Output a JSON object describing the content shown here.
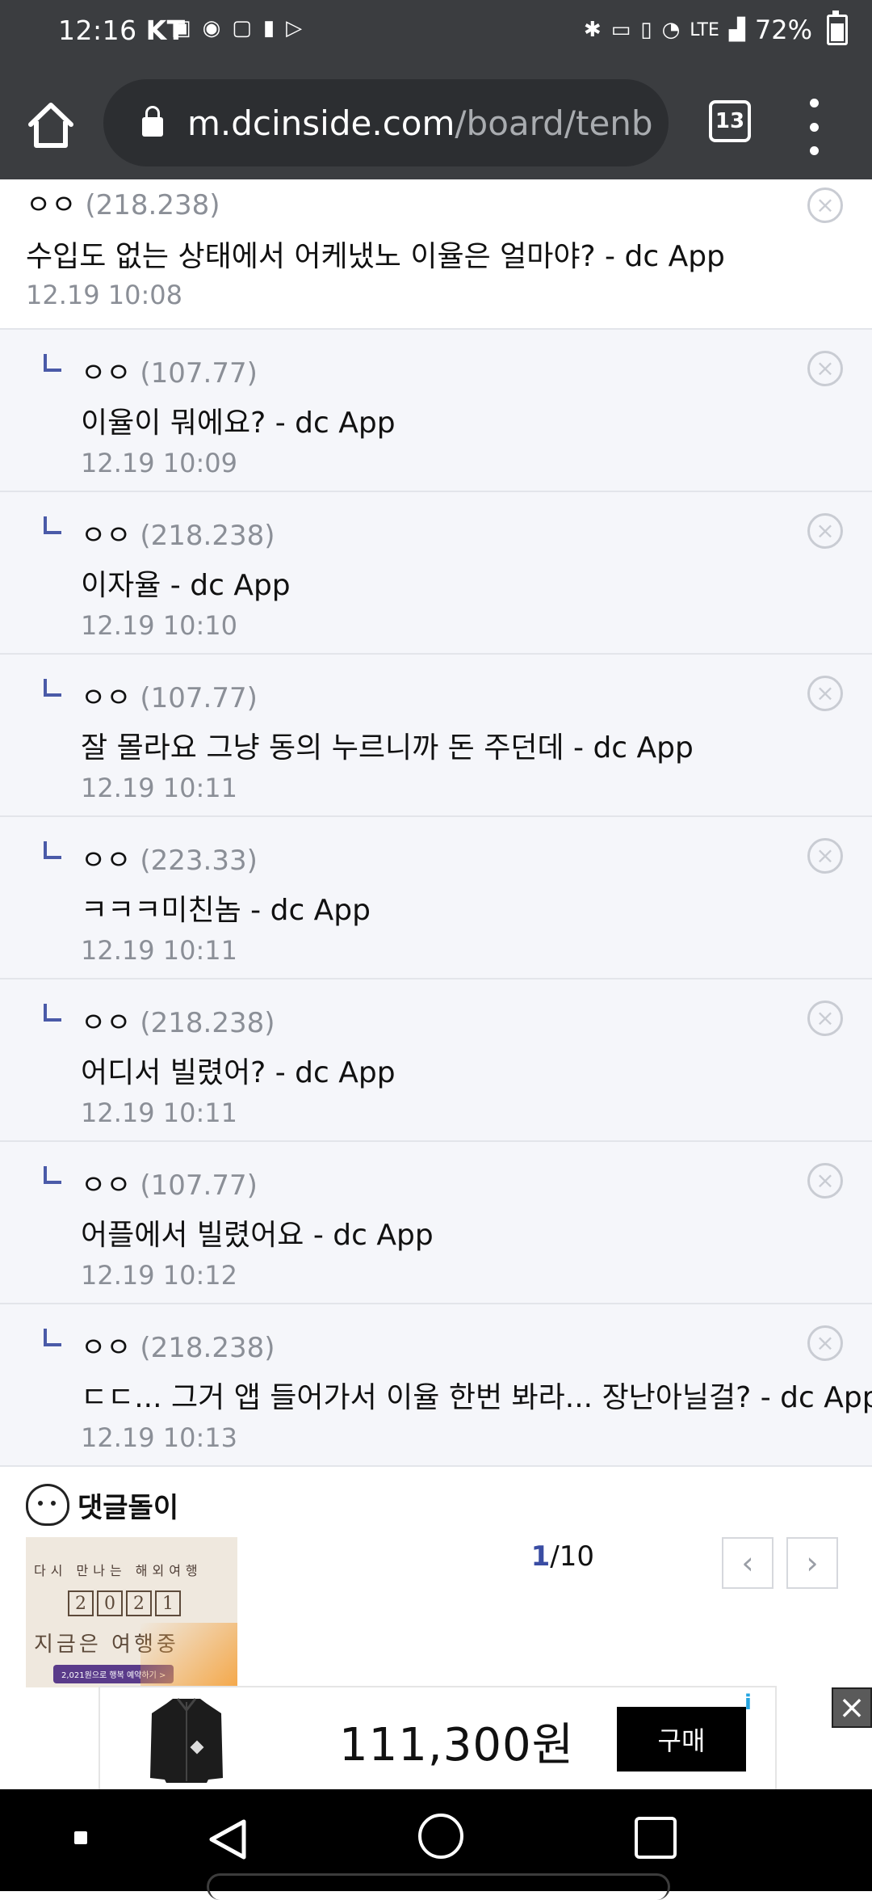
{
  "status_bar": {
    "time": "12:16",
    "carrier": "KT",
    "network": "LTE",
    "battery": "72%"
  },
  "browser": {
    "url_host": "m.dcinside.com",
    "url_path": "/board/tenb",
    "tab_count": "13"
  },
  "comments": [
    {
      "type": "root",
      "user": "ㅇㅇ",
      "ip": "(218.238)",
      "text": "수입도 없는 상태에서 어케냈노 이율은 얼마야? - dc App",
      "time": "12.19 10:08"
    },
    {
      "type": "reply",
      "user": "ㅇㅇ",
      "ip": "(107.77)",
      "text": "이율이 뭐에요? - dc App",
      "time": "12.19 10:09"
    },
    {
      "type": "reply",
      "user": "ㅇㅇ",
      "ip": "(218.238)",
      "text": "이자율 - dc App",
      "time": "12.19 10:10"
    },
    {
      "type": "reply",
      "user": "ㅇㅇ",
      "ip": "(107.77)",
      "text": "잘 몰라요 그냥 동의 누르니까 돈 주던데 - dc App",
      "time": "12.19 10:11"
    },
    {
      "type": "reply",
      "user": "ㅇㅇ",
      "ip": "(223.33)",
      "text": "ㅋㅋㅋ미친놈 - dc App",
      "time": "12.19 10:11"
    },
    {
      "type": "reply",
      "user": "ㅇㅇ",
      "ip": "(218.238)",
      "text": "어디서 빌렸어? - dc App",
      "time": "12.19 10:11"
    },
    {
      "type": "reply",
      "user": "ㅇㅇ",
      "ip": "(107.77)",
      "text": "어플에서 빌렸어요 - dc App",
      "time": "12.19 10:12"
    },
    {
      "type": "reply",
      "user": "ㅇㅇ",
      "ip": "(218.238)",
      "text": "ㄷㄷ... 그거 앱 들어가서 이율 한번 봐라... 장난아닐걸? - dc App",
      "time": "12.19 10:13"
    }
  ],
  "dolgul": {
    "title": "댓글돌이",
    "page_current": "1",
    "page_total": "/10",
    "thumb_line1": "다시 만나는 해외여행",
    "thumb_year": [
      "2",
      "0",
      "2",
      "1"
    ],
    "thumb_line3": "지금은 여행중",
    "thumb_button": "2,021원으로 행복 예약하기 >"
  },
  "ad": {
    "price": "111,300원",
    "buy_label": "구매",
    "info_icon": "i",
    "close_label": "×"
  },
  "colors": {
    "status_bar": "#3b3d40",
    "reply_bg": "#f5f6fa",
    "accent": "#3a4da3"
  }
}
